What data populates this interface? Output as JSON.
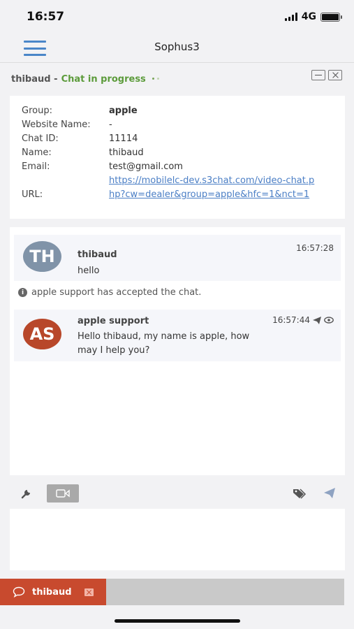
{
  "status_bar": {
    "time": "16:57",
    "network": "4G"
  },
  "app": {
    "title": "Sophus3"
  },
  "chat_header": {
    "visitor": "thibaud -",
    "status": "Chat in progress"
  },
  "info": {
    "rows": [
      {
        "label": "Group:",
        "value": "apple"
      },
      {
        "label": "Website Name:",
        "value": "-"
      },
      {
        "label": "Chat ID:",
        "value": "11114"
      },
      {
        "label": "Name:",
        "value": "thibaud"
      },
      {
        "label": "Email:",
        "value": "test@gmail.com"
      },
      {
        "label": "URL:",
        "value": "https://mobilelc-dev.s3chat.com/video-chat.php?cw=dealer&group=apple&hfc=1&nct=1"
      }
    ]
  },
  "messages": [
    {
      "initials": "TH",
      "sender": "thibaud",
      "time": "16:57:28",
      "text": "hello"
    },
    {
      "initials": "AS",
      "sender": "apple support",
      "time": "16:57:44",
      "text": "Hello thibaud, my name is apple, how may I help you?"
    }
  ],
  "system_message": "apple support has accepted the chat.",
  "compose": {
    "placeholder": ""
  },
  "bottom_tab": {
    "name": "thibaud"
  },
  "colors": {
    "accent_green": "#5c9b3b",
    "tab_red": "#c84a2e",
    "link_blue": "#4a7ec5",
    "menu_blue": "#4a86c8"
  },
  "icons": [
    "signal-icon",
    "battery-icon",
    "menu-icon",
    "minimize-icon",
    "close-icon",
    "info-icon",
    "sent-icon",
    "seen-icon",
    "wrench-icon",
    "video-icon",
    "tag-icon",
    "send-icon",
    "chat-bubble-icon"
  ]
}
